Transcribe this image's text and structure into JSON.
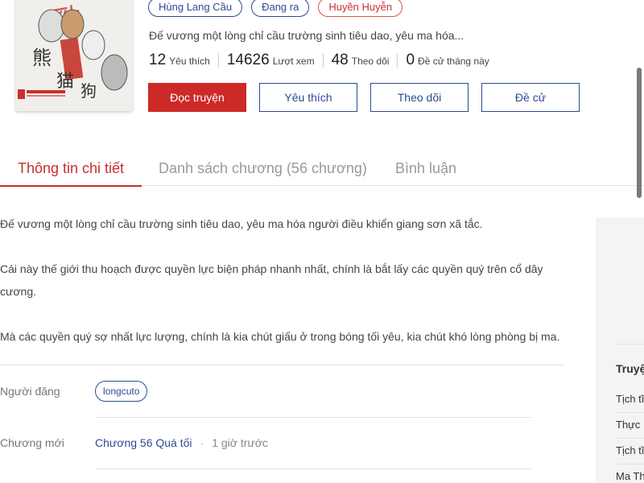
{
  "book": {
    "tags": [
      "Hùng Lang Cầu",
      "Đang ra",
      "Huyền Huyễn"
    ],
    "summary": "Đế vương một lòng chỉ cầu trường sinh tiêu dao, yêu ma hóa...",
    "stats": [
      {
        "value": "12",
        "label": "Yêu thích"
      },
      {
        "value": "14626",
        "label": "Lượt xem"
      },
      {
        "value": "48",
        "label": "Theo dõi"
      },
      {
        "value": "0",
        "label": "Đề cử tháng này"
      }
    ],
    "actions": {
      "read": "Đọc truyện",
      "favorite": "Yêu thích",
      "follow": "Theo dõi",
      "nominate": "Đề cử"
    }
  },
  "tabs": {
    "details": "Thông tin chi tiết",
    "chapters": "Danh sách chương (56 chương)",
    "comments": "Bình luận"
  },
  "description": [
    "Đế vương một lòng chỉ cầu trường sinh tiêu dao, yêu ma hóa người điều khiển giang sơn xã tắc.",
    "Cái này thế giới thu hoạch được quyền lực biện pháp nhanh nhất, chính là bắt lấy các quyền quý trên cổ dây cương.",
    "Mà các quyền quý sợ nhất lực lượng, chính là kia chút giấu ở trong bóng tối yêu, kia chút khó lòng phòng bị ma."
  ],
  "info": {
    "uploader_label": "Người đăng",
    "uploader": "longcuto",
    "latest_label": "Chương mới",
    "latest_chapter": "Chương 56 Quá tối",
    "latest_time": "1 giờ trước",
    "dot": "·"
  },
  "side": {
    "title": "Truyệ",
    "items": [
      "Tịch tĩ",
      "Thực ",
      "Tịch tĩ",
      "Ma Th"
    ]
  },
  "colors": {
    "accent_red": "#cc2a27",
    "link_blue": "#2d4a94"
  }
}
